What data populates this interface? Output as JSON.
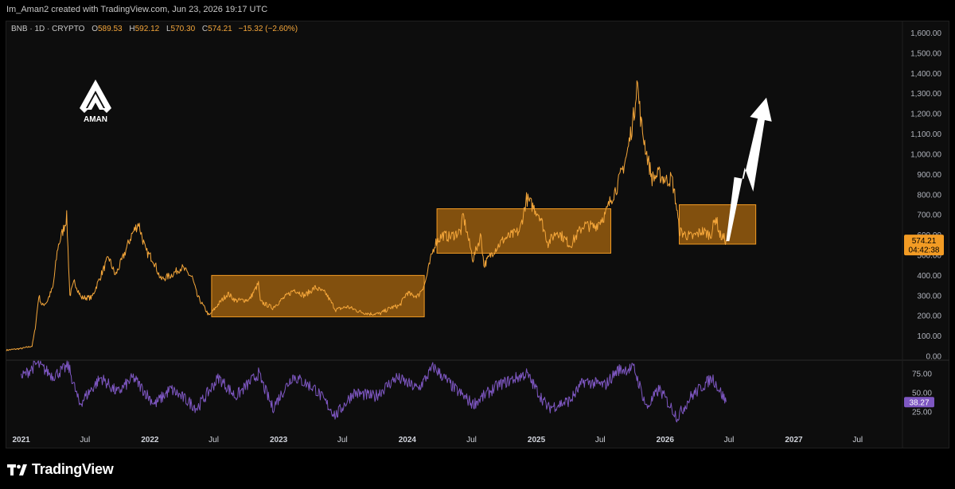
{
  "header": {
    "attribution": "Im_Aman2 created with TradingView.com, Jun 23, 2026 19:17 UTC"
  },
  "legend": {
    "symbol": "BNB · 1D · CRYPTO",
    "open_label": "O",
    "open": "589.53",
    "high_label": "H",
    "high": "592.12",
    "low_label": "L",
    "low": "570.30",
    "close_label": "C",
    "close": "574.21",
    "change": "−15.32 (−2.60%)"
  },
  "logo": {
    "text": "AMAN"
  },
  "brand": {
    "name": "TradingView"
  },
  "colors": {
    "price": "#f4a63a",
    "zone_fill": "#a0610f",
    "zone_border": "#f29b24",
    "rsi": "#7e57c2",
    "arrow": "#ffffff",
    "background": "#0d0d0d"
  },
  "price_tag": {
    "price": "574.21",
    "countdown": "04:42:38"
  },
  "rsi_tag": {
    "value": "38.27"
  },
  "chart_data": {
    "type": "line",
    "symbol": "BNB",
    "interval": "1D",
    "log_scale": false,
    "grid": false,
    "y_ticks": [
      0,
      100,
      200,
      300,
      400,
      500,
      600,
      700,
      800,
      900,
      1000,
      1100,
      1200,
      1300,
      1400,
      1500,
      1600
    ],
    "y_tick_labels": [
      "0.00",
      "100.00",
      "200.00",
      "300.00",
      "400.00",
      "500.00",
      "600.00",
      "700.00",
      "800.00",
      "900.00",
      "1,000.00",
      "1,100.00",
      "1,200.00",
      "1,300.00",
      "1,400.00",
      "1,500.00",
      "1,600.00"
    ],
    "ylim": [
      0,
      1640
    ],
    "xlim": [
      "2020-11-20",
      "2027-11-05"
    ],
    "x_ticks": [
      "2021-01-01",
      "2021-07-01",
      "2022-01-01",
      "2022-07-01",
      "2023-01-01",
      "2023-07-01",
      "2024-01-01",
      "2024-07-01",
      "2025-01-01",
      "2025-07-01",
      "2026-01-01",
      "2026-07-01",
      "2027-01-01",
      "2027-07-01"
    ],
    "x_tick_labels": [
      "2021",
      "Jul",
      "2022",
      "Jul",
      "2023",
      "Jul",
      "2024",
      "Jul",
      "2025",
      "Jul",
      "2026",
      "Jul",
      "2027",
      "Jul"
    ],
    "x_tick_bold": [
      true,
      false,
      true,
      false,
      true,
      false,
      true,
      false,
      true,
      false,
      true,
      false,
      true,
      false
    ],
    "series": [
      {
        "values": [
          [
            "2020-11-20",
            30
          ],
          [
            "2021-01-01",
            38
          ],
          [
            "2021-02-01",
            50
          ],
          [
            "2021-02-10",
            140
          ],
          [
            "2021-02-20",
            300
          ],
          [
            "2021-03-01",
            250
          ],
          [
            "2021-03-15",
            270
          ],
          [
            "2021-04-01",
            340
          ],
          [
            "2021-04-15",
            540
          ],
          [
            "2021-05-01",
            630
          ],
          [
            "2021-05-10",
            690
          ],
          [
            "2021-05-19",
            300
          ],
          [
            "2021-06-01",
            370
          ],
          [
            "2021-06-20",
            290
          ],
          [
            "2021-07-20",
            290
          ],
          [
            "2021-08-15",
            400
          ],
          [
            "2021-09-06",
            490
          ],
          [
            "2021-09-25",
            400
          ],
          [
            "2021-10-15",
            480
          ],
          [
            "2021-11-10",
            600
          ],
          [
            "2021-11-30",
            660
          ],
          [
            "2021-12-20",
            520
          ],
          [
            "2022-01-10",
            480
          ],
          [
            "2022-02-01",
            380
          ],
          [
            "2022-03-01",
            400
          ],
          [
            "2022-04-01",
            440
          ],
          [
            "2022-05-01",
            390
          ],
          [
            "2022-05-15",
            300
          ],
          [
            "2022-06-18",
            200
          ],
          [
            "2022-07-15",
            260
          ],
          [
            "2022-08-10",
            310
          ],
          [
            "2022-09-01",
            275
          ],
          [
            "2022-10-10",
            280
          ],
          [
            "2022-11-05",
            360
          ],
          [
            "2022-11-10",
            270
          ],
          [
            "2022-12-15",
            240
          ],
          [
            "2023-01-10",
            280
          ],
          [
            "2023-02-15",
            330
          ],
          [
            "2023-03-15",
            300
          ],
          [
            "2023-04-15",
            340
          ],
          [
            "2023-05-15",
            310
          ],
          [
            "2023-06-12",
            230
          ],
          [
            "2023-07-15",
            245
          ],
          [
            "2023-08-20",
            220
          ],
          [
            "2023-09-15",
            210
          ],
          [
            "2023-10-15",
            210
          ],
          [
            "2023-11-15",
            240
          ],
          [
            "2023-12-10",
            250
          ],
          [
            "2023-12-31",
            315
          ],
          [
            "2024-01-15",
            300
          ],
          [
            "2024-02-01",
            300
          ],
          [
            "2024-02-20",
            360
          ],
          [
            "2024-03-10",
            500
          ],
          [
            "2024-03-20",
            560
          ],
          [
            "2024-04-10",
            600
          ],
          [
            "2024-04-30",
            590
          ],
          [
            "2024-06-01",
            620
          ],
          [
            "2024-06-07",
            700
          ],
          [
            "2024-07-05",
            480
          ],
          [
            "2024-07-28",
            600
          ],
          [
            "2024-08-05",
            450
          ],
          [
            "2024-09-01",
            520
          ],
          [
            "2024-10-01",
            580
          ],
          [
            "2024-11-15",
            620
          ],
          [
            "2024-12-04",
            780
          ],
          [
            "2025-01-10",
            700
          ],
          [
            "2025-02-03",
            560
          ],
          [
            "2025-03-01",
            620
          ],
          [
            "2025-04-07",
            550
          ],
          [
            "2025-05-15",
            650
          ],
          [
            "2025-06-15",
            640
          ],
          [
            "2025-07-15",
            700
          ],
          [
            "2025-08-01",
            780
          ],
          [
            "2025-08-20",
            850
          ],
          [
            "2025-09-15",
            1000
          ],
          [
            "2025-09-25",
            1100
          ],
          [
            "2025-10-05",
            1200
          ],
          [
            "2025-10-13",
            1370
          ],
          [
            "2025-10-25",
            1150
          ],
          [
            "2025-11-10",
            1000
          ],
          [
            "2025-11-25",
            880
          ],
          [
            "2025-12-15",
            900
          ],
          [
            "2026-01-05",
            870
          ],
          [
            "2026-01-20",
            880
          ],
          [
            "2026-02-01",
            760
          ],
          [
            "2026-02-10",
            620
          ],
          [
            "2026-03-01",
            600
          ],
          [
            "2026-03-20",
            590
          ],
          [
            "2026-04-15",
            620
          ],
          [
            "2026-05-10",
            600
          ],
          [
            "2026-05-25",
            690
          ],
          [
            "2026-06-05",
            600
          ],
          [
            "2026-06-23",
            574
          ]
        ]
      },
      {
        "name": "RSI",
        "panel": "lower",
        "ylim": [
          10,
          90
        ],
        "y_ticks": [
          25,
          50,
          75
        ],
        "y_tick_labels": [
          "25.00",
          "50.00",
          "75.00"
        ],
        "values": [
          [
            "2021-01-01",
            70
          ],
          [
            "2021-02-15",
            88
          ],
          [
            "2021-04-01",
            72
          ],
          [
            "2021-05-15",
            85
          ],
          [
            "2021-06-15",
            35
          ],
          [
            "2021-08-15",
            70
          ],
          [
            "2021-10-01",
            50
          ],
          [
            "2021-11-15",
            70
          ],
          [
            "2022-01-15",
            35
          ],
          [
            "2022-03-01",
            55
          ],
          [
            "2022-05-15",
            30
          ],
          [
            "2022-07-15",
            70
          ],
          [
            "2022-09-01",
            45
          ],
          [
            "2022-11-05",
            75
          ],
          [
            "2022-12-15",
            30
          ],
          [
            "2023-02-10",
            72
          ],
          [
            "2023-04-15",
            55
          ],
          [
            "2023-06-12",
            20
          ],
          [
            "2023-08-01",
            50
          ],
          [
            "2023-10-01",
            45
          ],
          [
            "2023-12-01",
            70
          ],
          [
            "2024-02-01",
            55
          ],
          [
            "2024-03-15",
            84
          ],
          [
            "2024-05-15",
            55
          ],
          [
            "2024-07-05",
            35
          ],
          [
            "2024-09-15",
            60
          ],
          [
            "2024-12-04",
            75
          ],
          [
            "2025-02-03",
            30
          ],
          [
            "2025-04-07",
            40
          ],
          [
            "2025-05-15",
            65
          ],
          [
            "2025-07-15",
            60
          ],
          [
            "2025-08-20",
            80
          ],
          [
            "2025-10-05",
            82
          ],
          [
            "2025-11-10",
            30
          ],
          [
            "2025-12-15",
            55
          ],
          [
            "2026-02-05",
            18
          ],
          [
            "2026-03-15",
            45
          ],
          [
            "2026-05-15",
            70
          ],
          [
            "2026-06-23",
            38
          ]
        ]
      }
    ],
    "zones": [
      {
        "x0": "2022-06-25",
        "x1": "2024-02-18",
        "y0": 195,
        "y1": 400
      },
      {
        "x0": "2024-03-25",
        "x1": "2025-07-31",
        "y0": 510,
        "y1": 730
      },
      {
        "x0": "2026-02-10",
        "x1": "2026-09-15",
        "y0": 555,
        "y1": 750
      }
    ],
    "arrow": [
      [
        "2026-06-23",
        570
      ],
      [
        "2026-07-25",
        910
      ],
      [
        "2026-08-25",
        870
      ],
      [
        "2026-10-15",
        1280
      ]
    ]
  }
}
